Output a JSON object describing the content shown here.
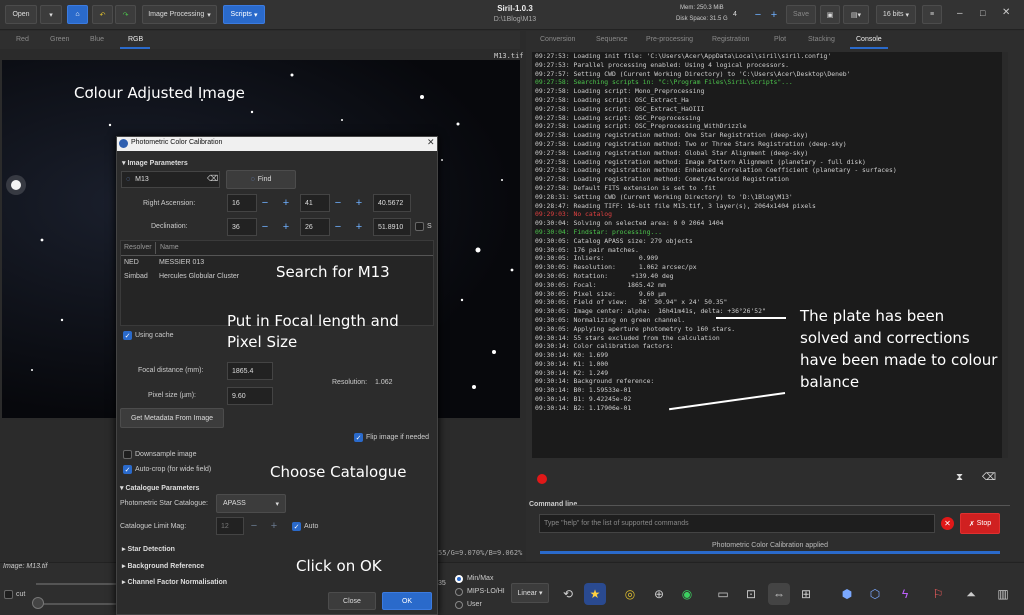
{
  "toolbar": {
    "open_label": "Open",
    "image_processing_label": "Image Processing",
    "scripts_label": "Scripts",
    "app_title": "Siril-1.0.3",
    "path": "D:\\1Blog\\M13",
    "mem": "Mem: 250.3 MiB",
    "disk": "Disk Space: 31.5 GiB",
    "threads": "4",
    "save_label": "Save",
    "bits_label": "16 bits"
  },
  "left_tabs": [
    "Red",
    "Green",
    "Blue",
    "RGB"
  ],
  "image_name": "M13.tif",
  "right_tabs": [
    "Conversion",
    "Sequence",
    "Pre-processing",
    "Registration",
    "Plot",
    "Stacking",
    "Console"
  ],
  "console_lines": [
    {
      "t": "09:27:53: Loading init file: 'C:\\Users\\Acer\\AppData\\Local\\siril\\siril.config'",
      "c": "#cfcfcf"
    },
    {
      "t": "09:27:53: Parallel processing enabled: Using 4 logical processors.",
      "c": "#cfcfcf"
    },
    {
      "t": "09:27:57: Setting CWD (Current Working Directory) to 'C:\\Users\\Acer\\Desktop\\Deneb'",
      "c": "#cfcfcf"
    },
    {
      "t": "09:27:58: Searching scripts in: \"C:\\Program Files\\SiriL\\scripts\"...",
      "c": "#4cc44c"
    },
    {
      "t": "09:27:58: Loading script: Mono_Preprocessing",
      "c": "#cfcfcf"
    },
    {
      "t": "09:27:58: Loading script: OSC_Extract_Ha",
      "c": "#cfcfcf"
    },
    {
      "t": "09:27:58: Loading script: OSC_Extract_HaOIII",
      "c": "#cfcfcf"
    },
    {
      "t": "09:27:58: Loading script: OSC_Preprocessing",
      "c": "#cfcfcf"
    },
    {
      "t": "09:27:58: Loading script: OSC_Preprocessing_WithDrizzle",
      "c": "#cfcfcf"
    },
    {
      "t": "09:27:58: Loading registration method: One Star Registration (deep-sky)",
      "c": "#cfcfcf"
    },
    {
      "t": "09:27:58: Loading registration method: Two or Three Stars Registration (deep-sky)",
      "c": "#cfcfcf"
    },
    {
      "t": "09:27:58: Loading registration method: Global Star Alignment (deep-sky)",
      "c": "#cfcfcf"
    },
    {
      "t": "09:27:58: Loading registration method: Image Pattern Alignment (planetary - full disk)",
      "c": "#cfcfcf"
    },
    {
      "t": "09:27:58: Loading registration method: Enhanced Correlation Coefficient (planetary - surfaces)",
      "c": "#cfcfcf"
    },
    {
      "t": "09:27:58: Loading registration method: Comet/Asteroid Registration",
      "c": "#cfcfcf"
    },
    {
      "t": "09:27:58: Default FITS extension is set to .fit",
      "c": "#cfcfcf"
    },
    {
      "t": "09:28:31: Setting CWD (Current Working Directory) to 'D:\\1Blog\\M13'",
      "c": "#cfcfcf"
    },
    {
      "t": "09:28:47: Reading TIFF: 16-bit file M13.tif, 3 layer(s), 2064x1404 pixels",
      "c": "#cfcfcf"
    },
    {
      "t": "09:29:03: No catalog",
      "c": "#e04040"
    },
    {
      "t": "09:30:04: Solving on selected area: 0 0 2064 1404",
      "c": "#cfcfcf"
    },
    {
      "t": "09:30:04: Findstar: processing...",
      "c": "#4cc44c"
    },
    {
      "t": "09:30:05: Catalog APASS size: 279 objects",
      "c": "#cfcfcf"
    },
    {
      "t": "09:30:05: 176 pair matches.",
      "c": "#cfcfcf"
    },
    {
      "t": "09:30:05: Inliers:         0.909",
      "c": "#cfcfcf"
    },
    {
      "t": "09:30:05: Resolution:      1.062 arcsec/px",
      "c": "#cfcfcf"
    },
    {
      "t": "09:30:05: Rotation:      +139.40 deg",
      "c": "#cfcfcf"
    },
    {
      "t": "09:30:05: Focal:        1865.42 mm",
      "c": "#cfcfcf"
    },
    {
      "t": "09:30:05: Pixel size:      9.60 µm",
      "c": "#cfcfcf"
    },
    {
      "t": "09:30:05: Field of view:   36' 30.94\" x 24' 50.35\"",
      "c": "#cfcfcf"
    },
    {
      "t": "09:30:05: Image center: alpha:  16h41m41s, delta: +36°26'52\"",
      "c": "#cfcfcf"
    },
    {
      "t": "09:30:05: Normalizing on green channel.",
      "c": "#cfcfcf"
    },
    {
      "t": "09:30:05: Applying aperture photometry to 160 stars.",
      "c": "#cfcfcf"
    },
    {
      "t": "09:30:14: 55 stars excluded from the calculation",
      "c": "#cfcfcf"
    },
    {
      "t": "09:30:14: Color calibration factors:",
      "c": "#cfcfcf"
    },
    {
      "t": "09:30:14: K0: 1.699",
      "c": "#cfcfcf"
    },
    {
      "t": "09:30:14: K1: 1.000",
      "c": "#cfcfcf"
    },
    {
      "t": "09:30:14: K2: 1.249",
      "c": "#cfcfcf"
    },
    {
      "t": "09:30:14: Background reference:",
      "c": "#cfcfcf"
    },
    {
      "t": "09:30:14: B0: 1.59533e-01",
      "c": "#cfcfcf"
    },
    {
      "t": "09:30:14: B1: 9.42245e-02",
      "c": "#cfcfcf"
    },
    {
      "t": "09:30:14: B2: 1.17906e-01",
      "c": "#cfcfcf"
    }
  ],
  "command_line": {
    "label": "Command line",
    "placeholder": "Type \"help\" for the list of supported commands",
    "stop_label": "Stop",
    "status": "Photometric Color Calibration applied"
  },
  "bottom": {
    "image_label": "Image:",
    "image_value": "M13.tif",
    "cut_label": "cut",
    "coords": "55/G=9.070%/B=9.062%",
    "scale_val": "35",
    "min_max": "Min/Max",
    "mips": "MIPS-LO/HI",
    "user": "User",
    "linear": "Linear"
  },
  "dialog": {
    "title": "Photometric Color Calibration",
    "image_params": "Image Parameters",
    "object_value": "M13",
    "find_label": "Find",
    "ra_label": "Right Ascension:",
    "ra": [
      "16",
      "41",
      "40.5672"
    ],
    "dec_label": "Declination:",
    "dec": [
      "36",
      "26",
      "51.8910"
    ],
    "s_label": "S",
    "resolver_header": "Resolver",
    "name_header": "Name",
    "rows": [
      {
        "resolver": "NED",
        "name": "MESSIER 013"
      },
      {
        "resolver": "Simbad",
        "name": "Hercules Globular Cluster"
      }
    ],
    "using_cache": "Using cache",
    "focal_label": "Focal distance (mm):",
    "focal_value": "1865.4",
    "pixel_label": "Pixel size (µm):",
    "pixel_value": "9.60",
    "resolution_label": "Resolution:",
    "resolution_value": "1.062",
    "metadata_btn": "Get Metadata From Image",
    "flip_label": "Flip image if needed",
    "downsample": "Downsample image",
    "autocrop": "Auto-crop (for wide field)",
    "catalogue_params": "Catalogue Parameters",
    "star_catalogue_label": "Photometric Star Catalogue:",
    "catalogue_value": "APASS",
    "limit_mag_label": "Catalogue Limit Mag:",
    "limit_mag_value": "12",
    "auto_label": "Auto",
    "star_detection": "Star Detection",
    "background_ref": "Background Reference",
    "channel_norm": "Channel Factor Normalisation",
    "close_label": "Close",
    "ok_label": "OK"
  },
  "annotations": {
    "colour_adjusted": "Colour Adjusted Image",
    "search": "Search for M13",
    "focal_pixel": [
      "Put in Focal length and",
      "Pixel Size"
    ],
    "choose_catalogue": "Choose Catalogue",
    "click_ok": "Click on OK",
    "plate_solved": [
      "The plate has been",
      "solved and corrections",
      "have been made to colour",
      "balance"
    ]
  }
}
